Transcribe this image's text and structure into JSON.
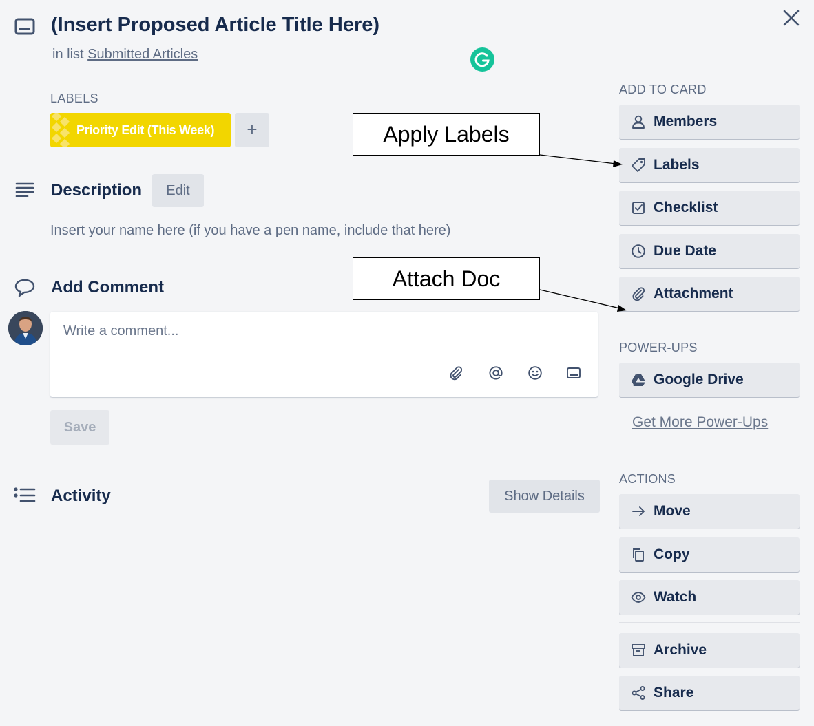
{
  "card": {
    "title": "(Insert Proposed Article Title Here)",
    "in_list_prefix": "in list",
    "list_name": "Submitted Articles"
  },
  "labels": {
    "heading": "LABELS",
    "items": [
      {
        "text": "Priority Edit (This Week)",
        "color": "#f2d600"
      }
    ],
    "add_button": "+"
  },
  "description": {
    "heading": "Description",
    "edit_button": "Edit",
    "text": "Insert your name here (if you have a pen name, include that here)"
  },
  "comment": {
    "heading": "Add Comment",
    "placeholder": "Write a comment...",
    "save_button": "Save",
    "toolbar_icons": [
      "paperclip-icon",
      "mention-icon",
      "emoji-icon",
      "card-icon"
    ]
  },
  "activity": {
    "heading": "Activity",
    "show_details_button": "Show Details"
  },
  "sidebar": {
    "add_to_card": {
      "heading": "ADD TO CARD",
      "items": [
        {
          "label": "Members",
          "icon": "person-icon"
        },
        {
          "label": "Labels",
          "icon": "tag-icon"
        },
        {
          "label": "Checklist",
          "icon": "checkbox-icon"
        },
        {
          "label": "Due Date",
          "icon": "clock-icon"
        },
        {
          "label": "Attachment",
          "icon": "paperclip-icon"
        }
      ]
    },
    "power_ups": {
      "heading": "POWER-UPS",
      "items": [
        {
          "label": "Google Drive",
          "icon": "google-drive-icon"
        }
      ],
      "more_link": "Get More Power-Ups"
    },
    "actions": {
      "heading": "ACTIONS",
      "items": [
        {
          "label": "Move",
          "icon": "arrow-right-icon"
        },
        {
          "label": "Copy",
          "icon": "copy-icon"
        },
        {
          "label": "Watch",
          "icon": "eye-icon"
        },
        {
          "label": "Archive",
          "icon": "archive-icon"
        },
        {
          "label": "Share",
          "icon": "share-icon"
        }
      ]
    }
  },
  "annotations": {
    "apply_labels": "Apply Labels",
    "attach_doc": "Attach Doc"
  },
  "colors": {
    "background": "#f4f5f7",
    "text_primary": "#172b4d",
    "text_secondary": "#5e6c84",
    "label_yellow": "#f2d600",
    "grammarly_green": "#15c39a"
  }
}
